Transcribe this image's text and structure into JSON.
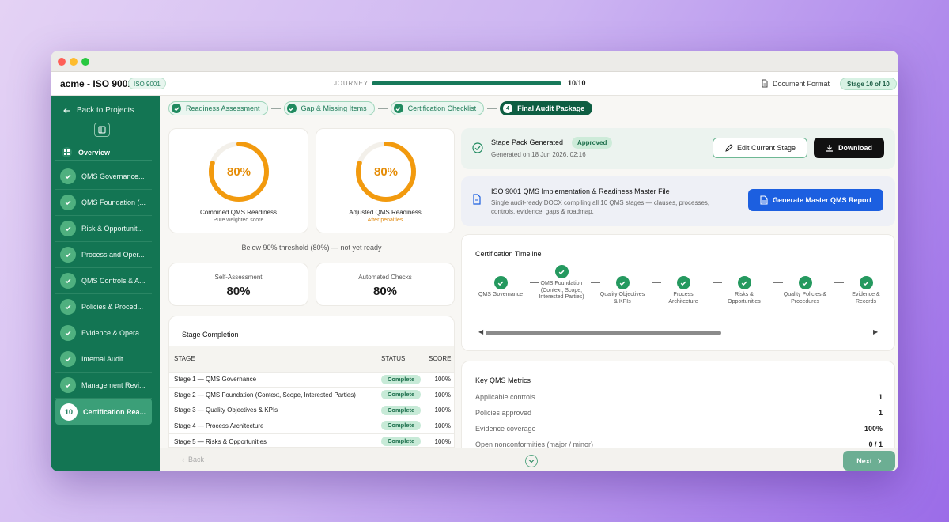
{
  "app": {
    "title": "acme - ISO 9001",
    "tag": "ISO 9001"
  },
  "journey": {
    "label": "JOURNEY",
    "count": "10/10",
    "progress": 1.0
  },
  "header": {
    "doc_format": "Document Format",
    "stage_pill": "Stage 10 of 10"
  },
  "sidebar": {
    "back": "Back to Projects",
    "overview": "Overview",
    "items": [
      {
        "label": "QMS Governance..."
      },
      {
        "label": "QMS Foundation (..."
      },
      {
        "label": "Risk & Opportunit..."
      },
      {
        "label": "Process and Oper..."
      },
      {
        "label": "QMS Controls & A..."
      },
      {
        "label": "Policies & Proced..."
      },
      {
        "label": "Evidence & Opera..."
      },
      {
        "label": "Internal Audit"
      },
      {
        "label": "Management Revi..."
      }
    ],
    "active": {
      "num": "10",
      "label": "Certification Rea..."
    }
  },
  "steps": [
    {
      "label": "Readiness Assessment"
    },
    {
      "label": "Gap & Missing Items"
    },
    {
      "label": "Certification Checklist"
    }
  ],
  "current_step": {
    "num": "4",
    "label": "Final Audit Package"
  },
  "readiness": {
    "combined": {
      "value": "80%",
      "fraction": 0.8,
      "label": "Combined QMS Readiness",
      "sub": "Pure weighted score"
    },
    "adjusted": {
      "value": "80%",
      "fraction": 0.8,
      "label": "Adjusted QMS Readiness",
      "sub": "After penalties"
    },
    "threshold": "Below 90% threshold (80%) — not yet ready",
    "self_assessment": {
      "label": "Self-Assessment",
      "value": "80%"
    },
    "automated_checks": {
      "label": "Automated Checks",
      "value": "80%"
    }
  },
  "stage_completion": {
    "title": "Stage Completion",
    "headers": [
      "STAGE",
      "STATUS",
      "SCORE"
    ],
    "rows": [
      {
        "stage": "Stage 1 — QMS Governance",
        "status": "Complete",
        "score": "100%"
      },
      {
        "stage": "Stage 2 — QMS Foundation (Context, Scope, Interested Parties)",
        "status": "Complete",
        "score": "100%"
      },
      {
        "stage": "Stage 3 — Quality Objectives & KPIs",
        "status": "Complete",
        "score": "100%"
      },
      {
        "stage": "Stage 4 — Process Architecture",
        "status": "Complete",
        "score": "100%"
      },
      {
        "stage": "Stage 5 — Risks & Opportunities",
        "status": "Complete",
        "score": "100%"
      }
    ]
  },
  "stage_pack": {
    "title": "Stage Pack Generated",
    "badge": "Approved",
    "generated": "Generated on 18 Jun 2026, 02:16",
    "edit_label": "Edit Current Stage",
    "download_label": "Download"
  },
  "master_file": {
    "title": "ISO 9001 QMS Implementation & Readiness Master File",
    "desc": "Single audit-ready DOCX compiling all 10 QMS stages — clauses, processes, controls, evidence, gaps & roadmap.",
    "button": "Generate Master QMS Report"
  },
  "timeline": {
    "title": "Certification Timeline",
    "nodes": [
      "QMS Governance",
      "QMS Foundation (Context, Scope, Interested Parties)",
      "Quality Objectives & KPIs",
      "Process Architecture",
      "Risks & Opportunities",
      "Quality Policies & Procedures",
      "Evidence & Records"
    ]
  },
  "metrics": {
    "title": "Key QMS Metrics",
    "rows": [
      {
        "label": "Applicable controls",
        "value": "1"
      },
      {
        "label": "Policies approved",
        "value": "1"
      },
      {
        "label": "Evidence coverage",
        "value": "100%"
      },
      {
        "label": "Open nonconformities (major / minor)",
        "value": "0 / 1"
      }
    ]
  },
  "footer": {
    "back": "Back",
    "next": "Next"
  },
  "colors": {
    "brand": "#137553",
    "ring": "#f29a0e",
    "primary_blue": "#1c5fe0"
  }
}
